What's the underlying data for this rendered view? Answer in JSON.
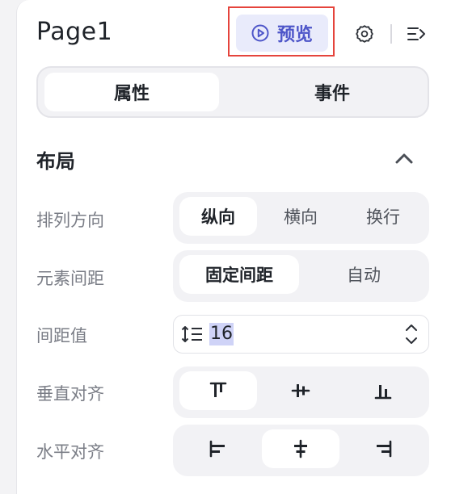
{
  "header": {
    "title": "Page1",
    "preview_label": "预览"
  },
  "main_tabs": [
    {
      "label": "属性",
      "active": true
    },
    {
      "label": "事件",
      "active": false
    }
  ],
  "layout_section": {
    "title": "布局",
    "rows": {
      "direction": {
        "label": "排列方向",
        "options": [
          {
            "label": "纵向",
            "active": true
          },
          {
            "label": "横向",
            "active": false
          },
          {
            "label": "换行",
            "active": false
          }
        ]
      },
      "spacing": {
        "label": "元素间距",
        "options": [
          {
            "label": "固定间距",
            "active": true
          },
          {
            "label": "自动",
            "active": false
          }
        ]
      },
      "gap_value": {
        "label": "间距值",
        "value": "16"
      },
      "vertical_align": {
        "label": "垂直对齐",
        "options": [
          {
            "icon": "align-top-icon",
            "active": true
          },
          {
            "icon": "align-middle-icon",
            "active": false
          },
          {
            "icon": "align-bottom-icon",
            "active": false
          }
        ]
      },
      "horizontal_align": {
        "label": "水平对齐",
        "options": [
          {
            "icon": "align-left-icon",
            "active": false
          },
          {
            "icon": "align-center-icon",
            "active": true
          },
          {
            "icon": "align-right-icon",
            "active": false
          }
        ]
      }
    }
  },
  "colors": {
    "accent": "#4e56c9",
    "accent_bg": "#e9ebfb",
    "highlight_border": "#e5443c",
    "label_gray": "#7a7d86",
    "segment_bg": "#f2f2f5"
  }
}
